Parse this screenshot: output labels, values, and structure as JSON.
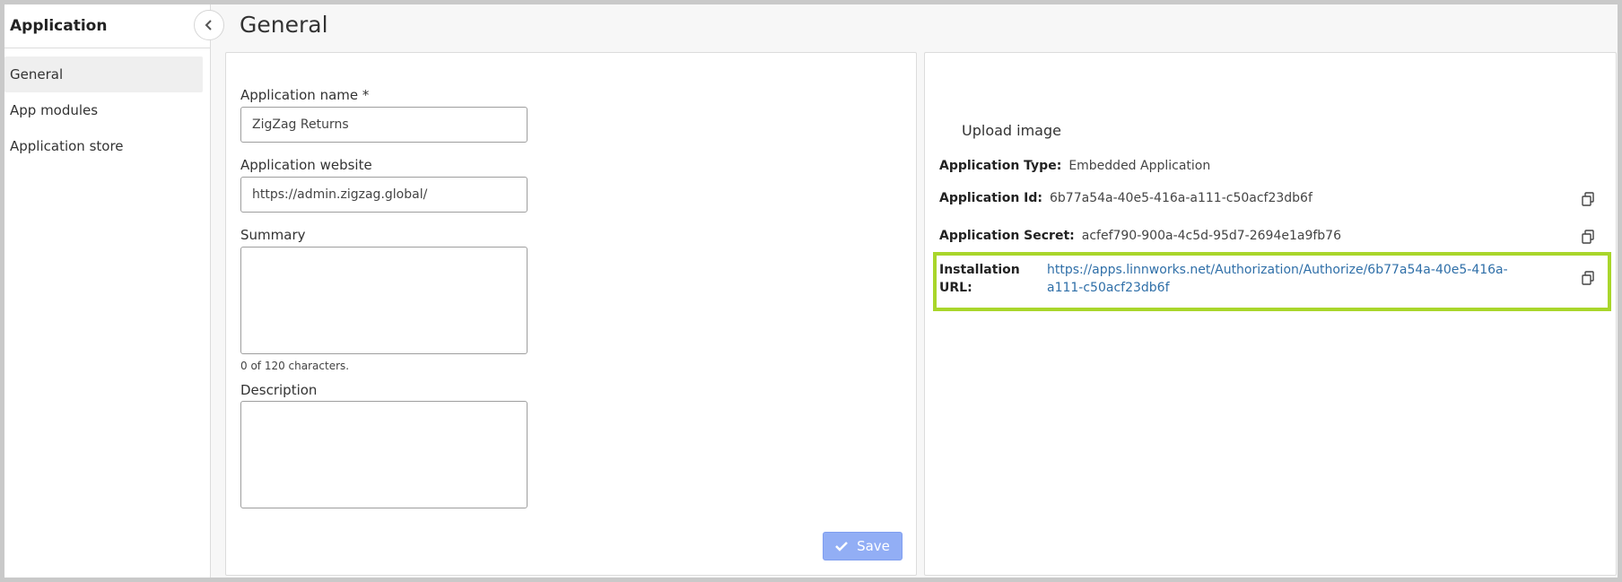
{
  "sidebar": {
    "title": "Application",
    "items": [
      {
        "label": "General",
        "active": true
      },
      {
        "label": "App modules",
        "active": false
      },
      {
        "label": "Application store",
        "active": false
      }
    ]
  },
  "header": {
    "title": "General"
  },
  "form": {
    "name_label": "Application name *",
    "name_value": "ZigZag Returns",
    "website_label": "Application website",
    "website_value": "https://admin.zigzag.global/",
    "summary_label": "Summary",
    "summary_value": "",
    "summary_count": "0 of 120 characters.",
    "description_label": "Description",
    "description_value": "",
    "save_label": "Save"
  },
  "info": {
    "upload_label": "Upload image",
    "type_label": "Application Type:",
    "type_value": "Embedded Application",
    "id_label": "Application Id:",
    "id_value": "6b77a54a-40e5-416a-a111-c50acf23db6f",
    "secret_label": "Application Secret:",
    "secret_value": "acfef790-900a-4c5d-95d7-2694e1a9fb76",
    "install_label": "Installation URL:",
    "install_url": "https://apps.linnworks.net/Authorization/Authorize/6b77a54a-40e5-416a-a111-c50acf23db6f"
  },
  "colors": {
    "highlight": "#a9d62b",
    "link": "#2f6fa8",
    "save_button": "#92aef5"
  },
  "icons": [
    "chevron-left-icon",
    "check-icon",
    "copy-icon"
  ]
}
